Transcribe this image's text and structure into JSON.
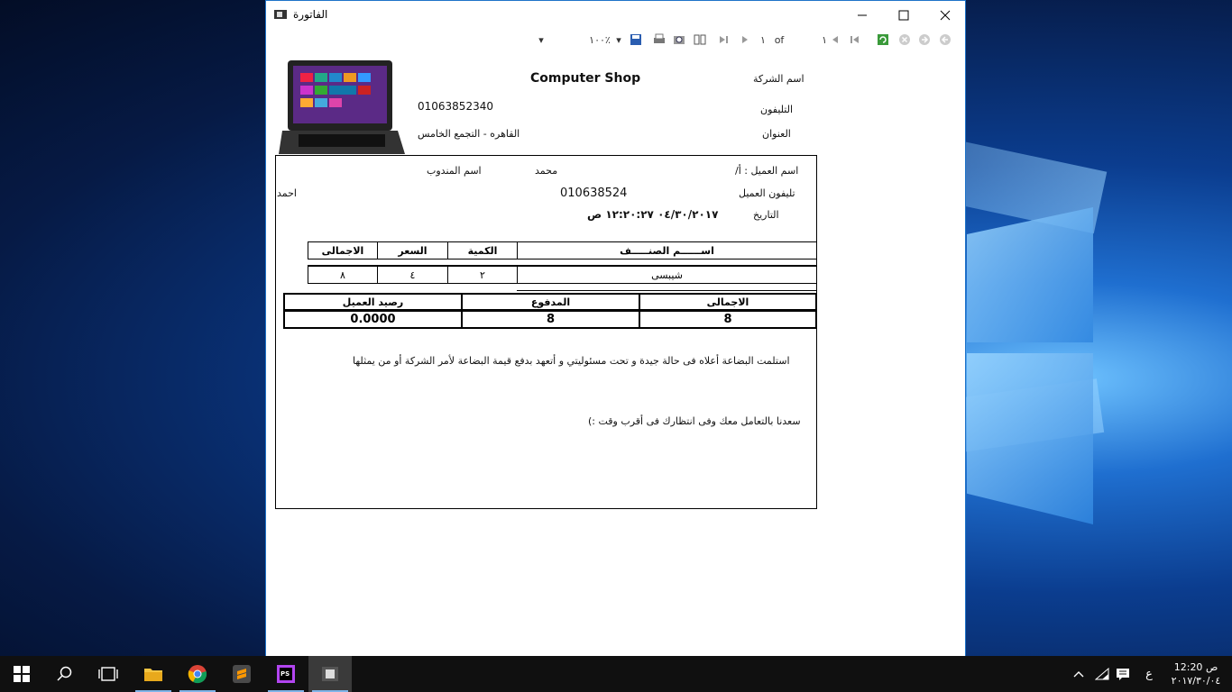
{
  "window": {
    "title": "الفاتورة"
  },
  "toolbar": {
    "zoom": "١٠٠٪",
    "page_current": "١",
    "page_of": "of",
    "page_total": "١"
  },
  "company": {
    "name_label": "اسم الشركة",
    "name": "Computer Shop",
    "phone_label": "التليفون",
    "phone": "01063852340",
    "address_label": "العنوان",
    "address": "القاهره - التجمع الخامس"
  },
  "customer": {
    "name_label": "اسم العميل : أ/",
    "name": "محمد",
    "rep_label": "اسم المندوب",
    "rep": "احمد",
    "phone_label": "تليفون العميل",
    "phone": "010638524",
    "date_label": "التاريخ",
    "date": "٠٤/٣٠/٢٠١٧  ١٢:٢٠:٢٧ ص"
  },
  "items_table": {
    "headers": [
      "اســــــم الصنـــــف",
      "الكمية",
      "السعر",
      "الاجمالى"
    ],
    "rows": [
      [
        "شيبسى",
        "٢",
        "٤",
        "٨"
      ]
    ]
  },
  "totals_table": {
    "headers": [
      "الاجمالى",
      "المدفوع",
      "رصيد العميل"
    ],
    "values": [
      "8",
      "8",
      "0.0000"
    ]
  },
  "notes": {
    "line1": "استلمت البضاعة أعلاه فى حالة جيدة و تحت مسئوليتي و أتعهد بدفع قيمة البضاعة لأمر الشركة أو من يمثلها",
    "line2": "سعدنا بالتعامل معك وفى انتظارك فى أقرب وقت :)"
  },
  "taskbar": {
    "clock_time": "12:20 ص",
    "clock_date": "٢٠١٧/٣٠/٠٤",
    "lang": "ع"
  }
}
